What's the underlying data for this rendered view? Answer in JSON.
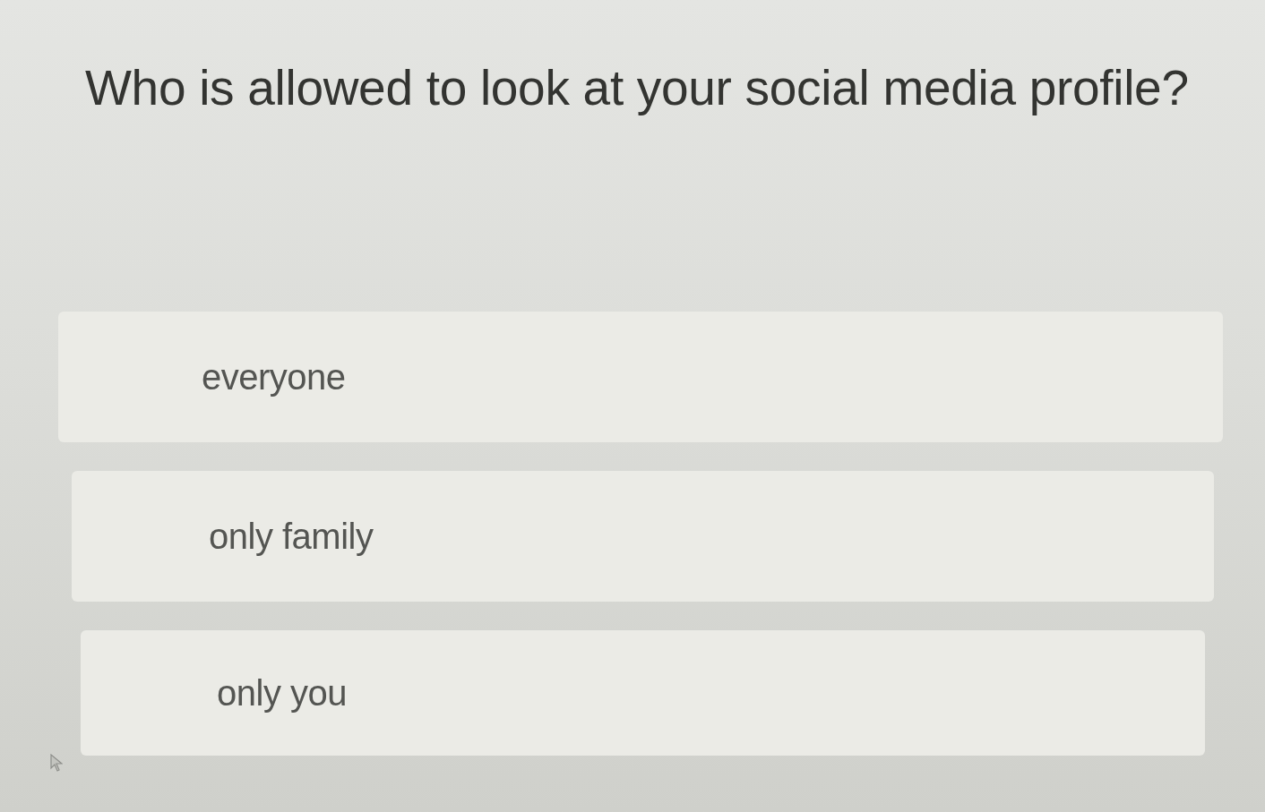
{
  "question": "Who is allowed to look at your social media profile?",
  "options": [
    {
      "label": "everyone",
      "selected": false
    },
    {
      "label": "only family",
      "selected": false
    },
    {
      "label": "only you",
      "selected": false
    }
  ]
}
